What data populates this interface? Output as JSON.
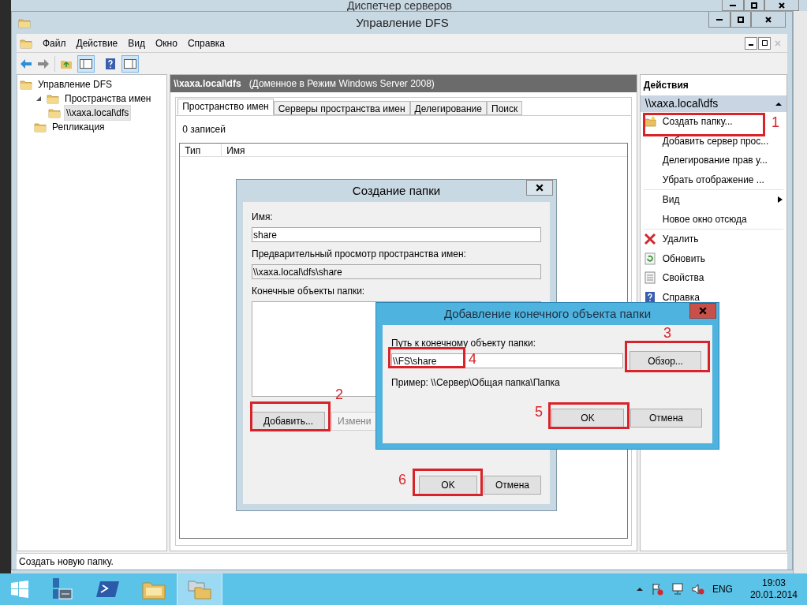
{
  "background_window": {
    "title": "Диспетчер серверов"
  },
  "window": {
    "title": "Управление DFS"
  },
  "menu": [
    "Файл",
    "Действие",
    "Вид",
    "Окно",
    "Справка"
  ],
  "tree": [
    {
      "label": "Управление DFS",
      "selected": false,
      "children": [
        {
          "label": "Пространства имен",
          "selected": false,
          "expanded": true,
          "children": [
            {
              "label": "\\\\xaxa.local\\dfs",
              "selected": true
            }
          ]
        },
        {
          "label": "Репликация",
          "selected": false
        }
      ]
    }
  ],
  "content": {
    "path": "\\\\xaxa.local\\dfs",
    "mode": "(Доменное в Режим Windows Server 2008)",
    "tabs": [
      {
        "label": "Пространство имен",
        "selected": true
      },
      {
        "label": "Серверы пространства имен",
        "selected": false
      },
      {
        "label": "Делегирование",
        "selected": false
      },
      {
        "label": "Поиск",
        "selected": false
      }
    ],
    "count": "0 записей",
    "columns": [
      "Тип",
      "Имя"
    ]
  },
  "actions": {
    "title": "Действия",
    "group": "\\\\xaxa.local\\dfs",
    "items": [
      {
        "kind": "action",
        "label": "Создать папку..."
      },
      {
        "kind": "action",
        "label": "Добавить сервер прос..."
      },
      {
        "kind": "action",
        "label": "Делегирование прав у..."
      },
      {
        "kind": "action",
        "label": "Убрать отображение ..."
      },
      {
        "kind": "separator"
      },
      {
        "kind": "submenu",
        "label": "Вид"
      },
      {
        "kind": "action",
        "label": "Новое окно отсюда"
      },
      {
        "kind": "separator"
      },
      {
        "kind": "action",
        "label": "Удалить"
      },
      {
        "kind": "action",
        "label": "Обновить"
      },
      {
        "kind": "action",
        "label": "Свойства"
      },
      {
        "kind": "action",
        "label": "Справка"
      }
    ]
  },
  "status_bar": "Создать новую папку.",
  "dialog_new_folder": {
    "title": "Создание папки",
    "name_label": "Имя:",
    "name_value": "share",
    "preview_label": "Предварительный просмотр пространства имен:",
    "preview_value": "\\\\xaxa.local\\dfs\\share",
    "targets_label": "Конечные объекты папки:",
    "add_button": "Добавить...",
    "edit_button": {
      "label": "Измени",
      "disabled": true
    },
    "ok_button": "OK",
    "cancel_button": "Отмена"
  },
  "dialog_add_target": {
    "title": "Добавление конечного объекта папки",
    "path_label": "Путь к конечному объекту папки:",
    "path_value": "\\\\FS\\share",
    "browse_button": "Обзор...",
    "example": "Пример: \\\\Сервер\\Общая папка\\Папка",
    "ok_button": "OK",
    "cancel_button": "Отмена"
  },
  "annotations": [
    {
      "number": "1"
    },
    {
      "number": "2"
    },
    {
      "number": "3"
    },
    {
      "number": "4"
    },
    {
      "number": "5"
    },
    {
      "number": "6"
    }
  ],
  "taskbar": {
    "apps": [
      {
        "kind": "server-manager",
        "selected": false
      },
      {
        "kind": "powershell",
        "selected": false
      },
      {
        "kind": "explorer",
        "selected": false
      },
      {
        "kind": "dfs",
        "selected": true
      }
    ],
    "language": "ENG",
    "time": "19:03",
    "date": "20.01.2014"
  }
}
